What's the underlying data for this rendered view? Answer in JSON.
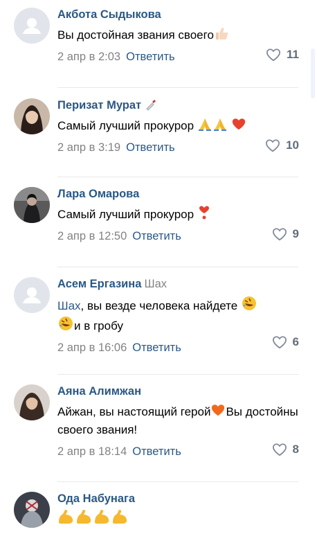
{
  "comments": [
    {
      "author": "Акбота Сыдыкова",
      "author_extra": "",
      "text": "Вы достойная звания своего",
      "date": "2 апр в 2:03",
      "reply_label": "Ответить",
      "likes": "11",
      "avatar": "placeholder-avatar"
    },
    {
      "author": "Перизат Мурат",
      "author_extra": "",
      "text": "Самый лучший прокурор",
      "date": "2 апр в 3:19",
      "reply_label": "Ответить",
      "likes": "10",
      "avatar": "photo-avatar"
    },
    {
      "author": "Лара Омарова",
      "author_extra": "",
      "text": "Самый лучший прокурор",
      "date": "2 апр в 12:50",
      "reply_label": "Ответить",
      "likes": "9",
      "avatar": "photo-avatar"
    },
    {
      "author": "Асем Ергазина",
      "author_extra": "Шах",
      "mention": "Шах",
      "text": ", вы везде человека найдете",
      "text2": "и в гробу",
      "date": "2 апр в 16:06",
      "reply_label": "Ответить",
      "likes": "6",
      "avatar": "placeholder-avatar"
    },
    {
      "author": "Аяна Алимжан",
      "author_extra": "",
      "text": "Айжан, вы настоящий герой",
      "text2": "Вы достойны своего звания!",
      "date": "2 апр в 18:14",
      "reply_label": "Ответить",
      "likes": "8",
      "avatar": "photo-avatar"
    },
    {
      "author": "Ода Набунага",
      "author_extra": "",
      "text": "",
      "avatar": "photo-avatar"
    }
  ],
  "colors": {
    "link": "#2a5885",
    "meta": "#828282",
    "likes": "#626d7a",
    "divider": "#e7e8ec"
  }
}
